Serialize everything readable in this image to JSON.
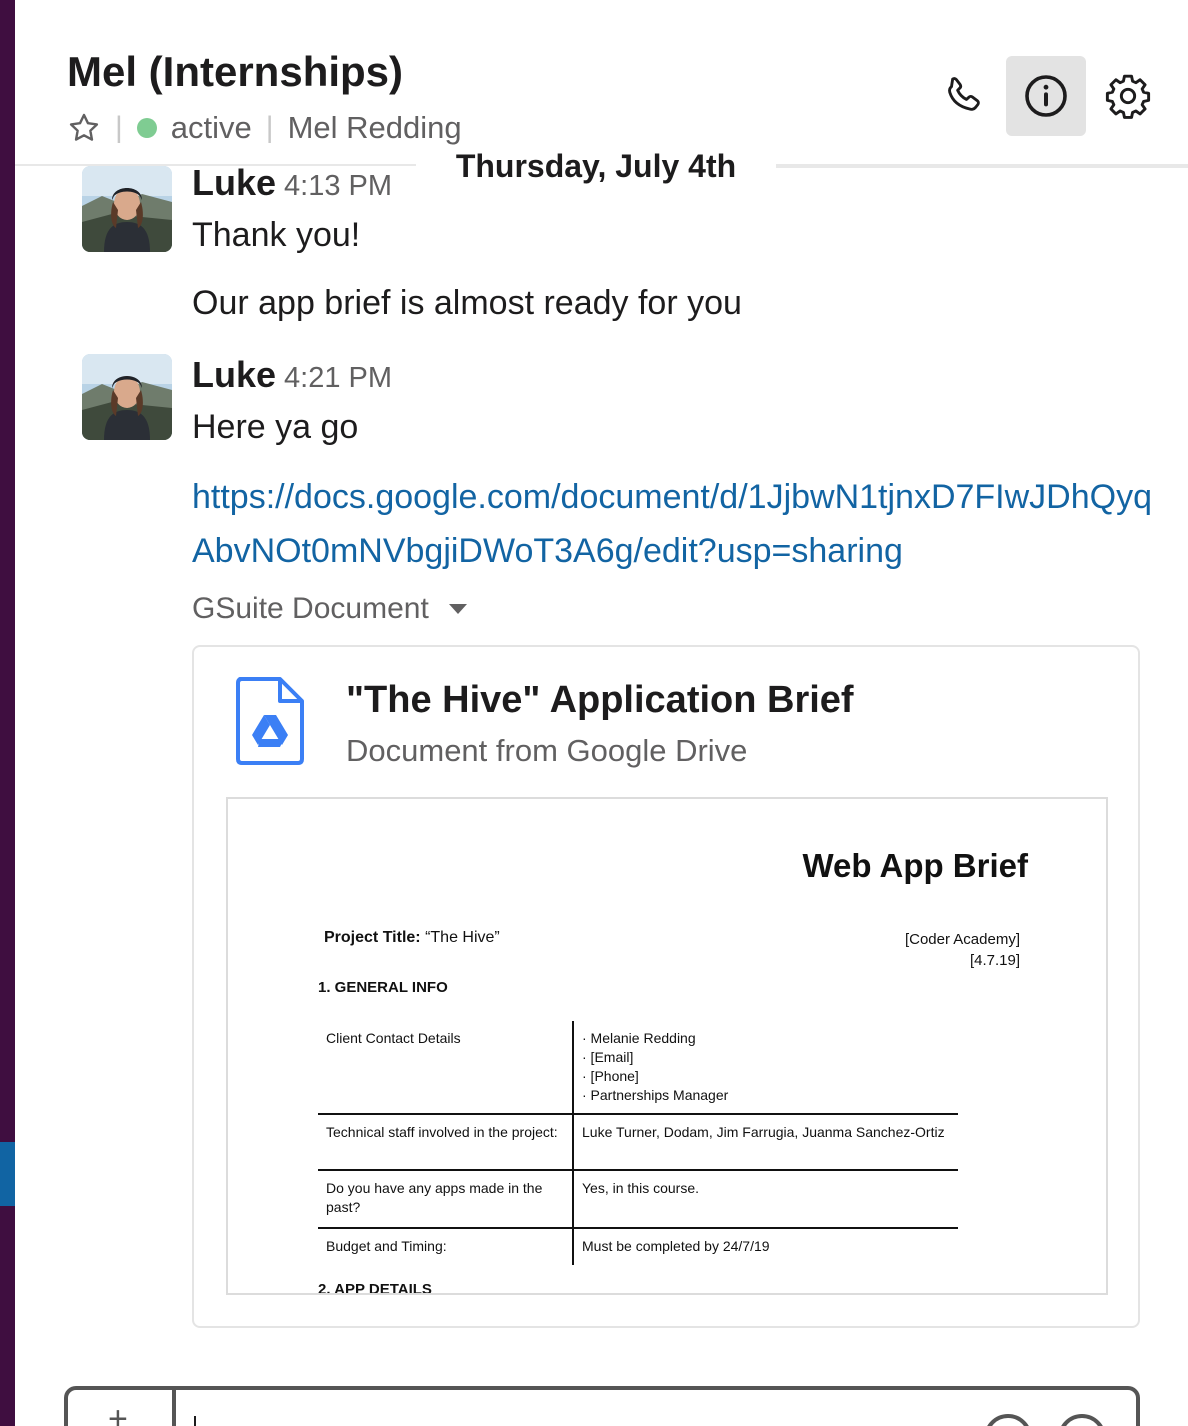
{
  "header": {
    "channel_title": "Mel (Internships)",
    "status": "active",
    "member_name": "Mel Redding",
    "colors": {
      "presence": "#7fcc92",
      "sidebar": "#3f0e40",
      "link": "#1264a3"
    }
  },
  "date_divider": "Thursday, July 4th",
  "messages": [
    {
      "sender": "Luke",
      "time": "4:13 PM",
      "lines": [
        "Thank you!",
        "Our app brief is almost ready for you"
      ]
    },
    {
      "sender": "Luke",
      "time": "4:21 PM",
      "lines": [
        "Here ya go"
      ],
      "link": "https://docs.google.com/document/d/1JjbwN1tjnxD7FIwJDhQyqAbvNOt0mNVbgjiDWoT3A6g/edit?usp=sharing"
    }
  ],
  "attachment": {
    "label": "GSuite Document",
    "title": "\"The Hive\" Application Brief",
    "subtitle": "Document from Google Drive",
    "preview": {
      "heading": "Web App Brief",
      "project_label": "Project Title:",
      "project_value": "“The Hive”",
      "org": "[Coder Academy]",
      "date": "[4.7.19]",
      "section1": "1. GENERAL INFO",
      "section2": "2. APP DETAILS",
      "rows": [
        {
          "label": "Client Contact Details",
          "value": [
            "· Melanie Redding",
            "· [Email]",
            "· [Phone]",
            "· Partnerships Manager"
          ]
        },
        {
          "label": "Technical staff involved in the project:",
          "value": [
            "Luke Turner, Dodam, Jim Farrugia, Juanma Sanchez-Ortiz"
          ]
        },
        {
          "label": "Do you have any apps made in the past?",
          "value": [
            "Yes, in this course."
          ]
        },
        {
          "label": "Budget and Timing:",
          "value": [
            "Must be completed by 24/7/19"
          ]
        }
      ]
    }
  },
  "composer": {
    "plus": "+"
  }
}
